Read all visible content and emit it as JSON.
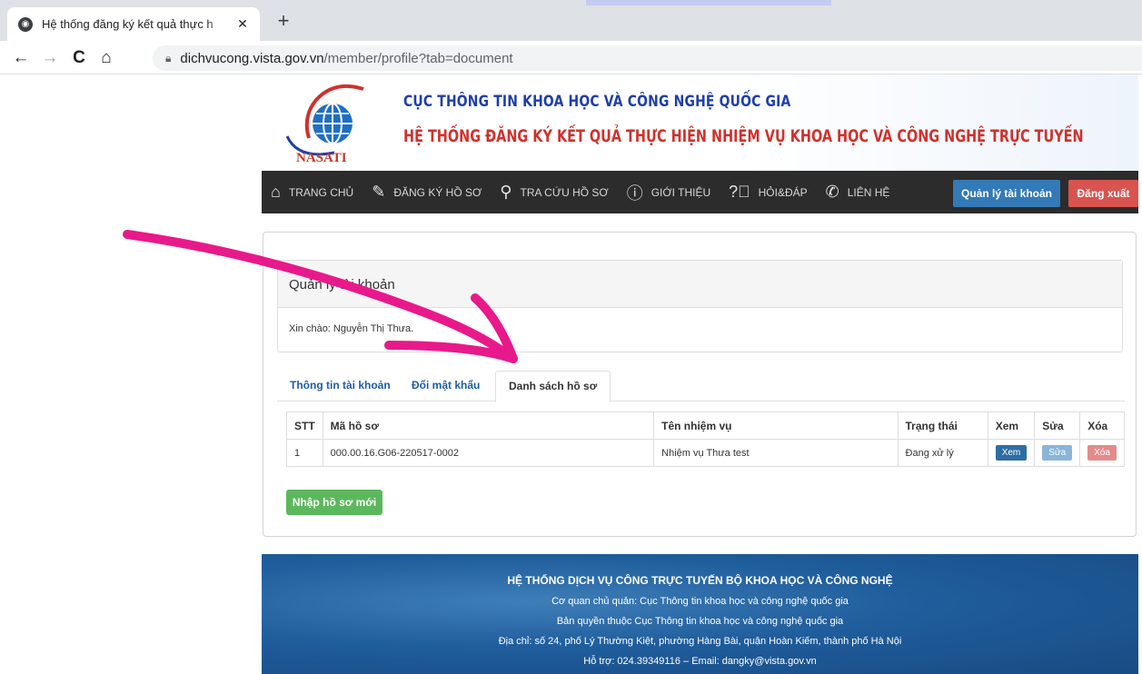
{
  "browser": {
    "tab_title": "Hệ thống đăng ký kết quả thực h",
    "tab_close": "✕",
    "new_tab": "+",
    "url_host": "dichvucong.vista.gov.vn",
    "url_path": "/member/profile?tab=document"
  },
  "header": {
    "logo_text": "NASATI",
    "agency": "CỤC THÔNG TIN KHOA HỌC VÀ CÔNG NGHỆ QUỐC GIA",
    "system": "HỆ THỐNG ĐĂNG KÝ KẾT QUẢ THỰC HIỆN NHIỆM VỤ KHOA HỌC VÀ CÔNG NGHỆ TRỰC TUYẾN"
  },
  "nav": {
    "items": [
      {
        "label": "TRANG CHỦ",
        "icon": "home-icon"
      },
      {
        "label": "ĐĂNG KÝ HỒ SƠ",
        "icon": "edit-document-icon"
      },
      {
        "label": "TRA CỨU HỒ SƠ",
        "icon": "search-icon"
      },
      {
        "label": "GIỚI THIỆU",
        "icon": "info-icon"
      },
      {
        "label": "HỎI&ĐÁP",
        "icon": "question-icon"
      },
      {
        "label": "LIÊN HỆ",
        "icon": "phone-icon"
      }
    ],
    "account_button": "Quản lý tài khoản",
    "logout_button": "Đăng xuất"
  },
  "account": {
    "heading": "Quản lý tài khoản",
    "greeting": "Xin chào: Nguyễn Thị Thưa."
  },
  "tabs": [
    {
      "label": "Thông tin tài khoản"
    },
    {
      "label": "Đổi mật khẩu"
    },
    {
      "label": "Danh sách hồ sơ",
      "active": true
    }
  ],
  "table": {
    "headers": [
      "STT",
      "Mã hồ sơ",
      "Tên nhiệm vụ",
      "Trạng thái",
      "Xem",
      "Sửa",
      "Xóa"
    ],
    "rows": [
      {
        "stt": "1",
        "code": "000.00.16.G06-220517-0002",
        "task": "Nhiệm vụ Thưa test",
        "status": "Đang xử lý",
        "view": "Xem",
        "edit": "Sửa",
        "delete": "Xóa"
      }
    ]
  },
  "new_button": "Nhập hồ sơ mới",
  "footer": {
    "title": "HỆ THỐNG DỊCH VỤ CÔNG TRỰC TUYẾN BỘ KHOA HỌC VÀ CÔNG NGHỆ",
    "line1": "Cơ quan chủ quản: Cục Thông tin khoa học và công nghệ quốc gia",
    "line2": "Bản quyền thuộc Cục Thông tin khoa học và công nghệ quốc gia",
    "line3": "Địa chỉ: số 24, phố Lý Thường Kiệt, phường Hàng Bài, quận Hoàn Kiếm, thành phố Hà Nội",
    "line4": "Hỗ trợ:  024.39349116 – Email: dangky@vista.gov.vn"
  },
  "colors": {
    "annotation": "#e8198b",
    "nav_bg": "#2c2c2c",
    "primary": "#337ab7",
    "danger": "#d9534f",
    "success": "#5cb85c"
  }
}
